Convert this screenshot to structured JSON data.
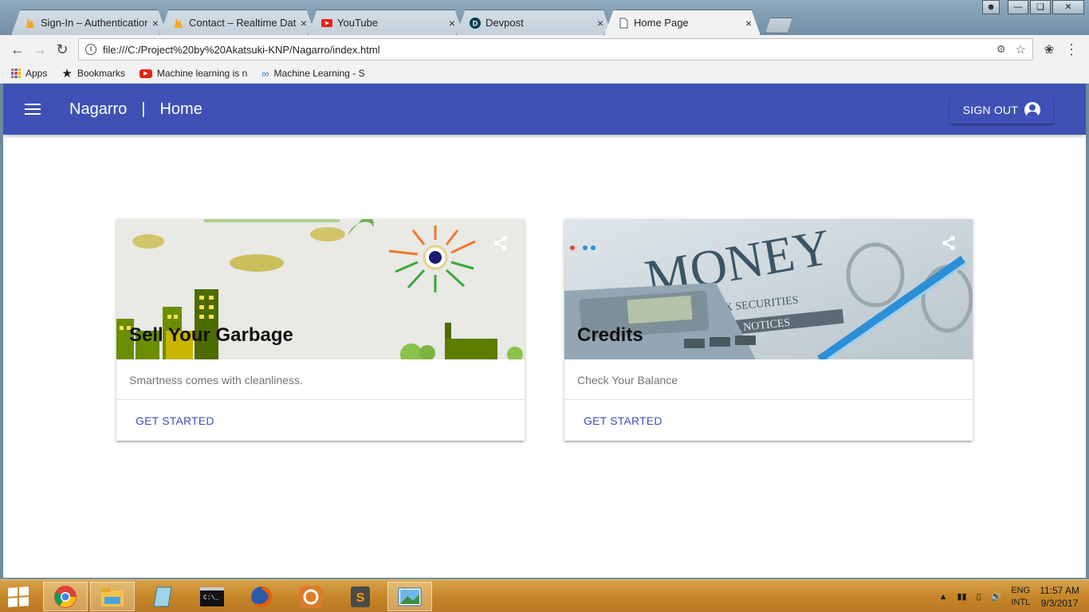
{
  "browser": {
    "tabs": [
      {
        "title": "Sign-In – Authentication",
        "icon": "firebase-icon",
        "active": false
      },
      {
        "title": "Contact – Realtime Data",
        "icon": "firebase-icon",
        "active": false
      },
      {
        "title": "YouTube",
        "icon": "youtube-icon",
        "active": false
      },
      {
        "title": "Devpost",
        "icon": "devpost-icon",
        "active": false
      },
      {
        "title": "Home Page",
        "icon": "document-icon",
        "active": true
      }
    ],
    "url": "file:///C:/Project%20by%20Akatsuki-KNP/Nagarro/index.html",
    "bookmarks": [
      {
        "label": "Apps",
        "icon": "apps-grid-icon"
      },
      {
        "label": "Bookmarks",
        "icon": "star-icon"
      },
      {
        "label": "Machine learning is n",
        "icon": "youtube-icon"
      },
      {
        "label": "Machine Learning - S",
        "icon": "link-icon"
      }
    ]
  },
  "app_bar": {
    "brand": "Nagarro",
    "separator": "|",
    "page": "Home",
    "signout_label": "SIGN OUT",
    "color": "#3f51b5"
  },
  "cards": [
    {
      "title": "Sell Your Garbage",
      "text": "Smartness comes with cleanliness.",
      "action": "GET STARTED",
      "image": "green-city-illustration"
    },
    {
      "title": "Credits",
      "text": "Check Your Balance",
      "action": "GET STARTED",
      "image": "money-newspaper-photo"
    }
  ],
  "taskbar": {
    "apps": [
      "chrome-icon",
      "file-explorer-icon",
      "notepad-icon",
      "cmd-icon",
      "firefox-icon",
      "app-icon",
      "sublime-icon",
      "photos-icon"
    ],
    "language": "ENG",
    "layout": "INTL",
    "time": "11:57 AM",
    "date": "9/3/2017"
  }
}
